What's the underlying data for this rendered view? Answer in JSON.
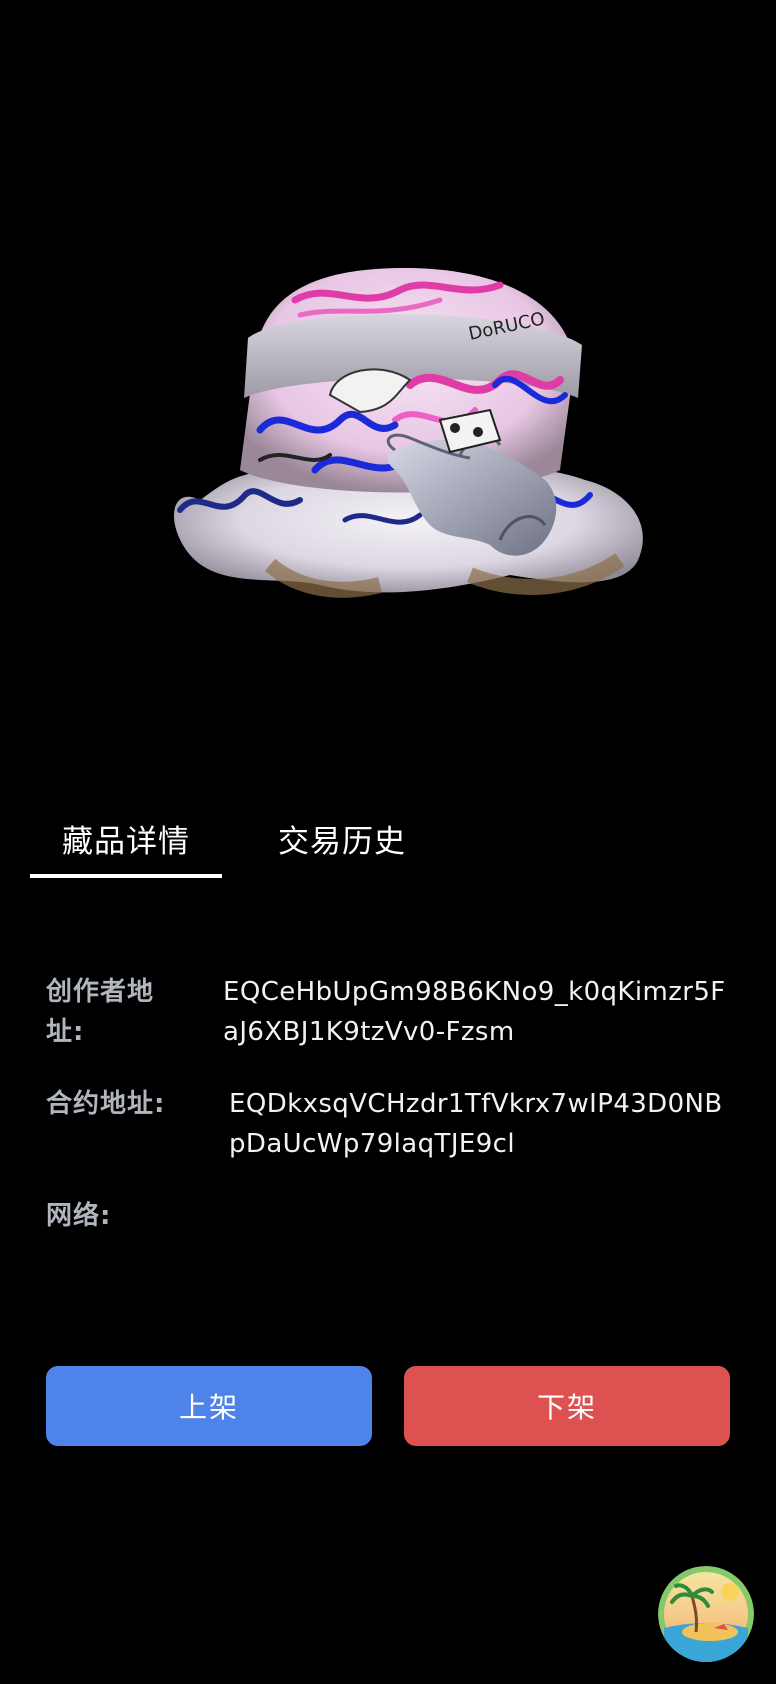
{
  "tabs": [
    {
      "label": "藏品详情",
      "active": true
    },
    {
      "label": "交易历史",
      "active": false
    }
  ],
  "details": {
    "creator": {
      "label": "创作者地址:",
      "value": "EQCeHbUpGm98B6KNo9_k0qKimzr5FaJ6XBJ1K9tzVv0-Fzsm"
    },
    "contract": {
      "label": "合约地址:",
      "value": "EQDkxsqVCHzdr1TfVkrx7wIP43D0NBpDaUcWp79laqTJE9cl"
    },
    "network": {
      "label": "网络:",
      "value": ""
    }
  },
  "buttons": {
    "list_label": "上架",
    "delist_label": "下架"
  },
  "hero_text": "DoRUCO",
  "colors": {
    "background": "#000000",
    "list_button": "#4e84e9",
    "delist_button": "#dd5250",
    "label_text": "#b1b5bd"
  },
  "icons": {
    "floating": "beach-island-icon"
  }
}
